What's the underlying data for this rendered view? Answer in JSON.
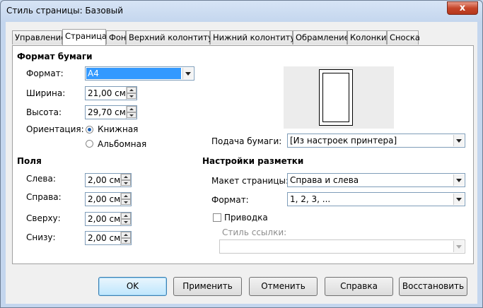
{
  "window": {
    "title": "Стиль страницы: Базовый",
    "close_glyph": "x"
  },
  "tabs": [
    {
      "label": "Управление"
    },
    {
      "label": "Страница"
    },
    {
      "label": "Фон"
    },
    {
      "label": "Верхний колонтитул"
    },
    {
      "label": "Нижний колонтитул"
    },
    {
      "label": "Обрамление"
    },
    {
      "label": "Колонки"
    },
    {
      "label": "Сноска"
    }
  ],
  "paper_format": {
    "heading": "Формат бумаги",
    "format_label": "Формат:",
    "format_value": "A4",
    "width_label": "Ширина:",
    "width_value": "21,00 см",
    "height_label": "Высота:",
    "height_value": "29,70 см",
    "orientation_label": "Ориентация:",
    "portrait_label": "Книжная",
    "landscape_label": "Альбомная",
    "paper_tray_label": "Подача бумаги:",
    "paper_tray_value": "[Из настроек принтера]"
  },
  "margins": {
    "heading": "Поля",
    "left_label": "Слева:",
    "left_value": "2,00 см",
    "right_label": "Справа:",
    "right_value": "2,00 см",
    "top_label": "Сверху:",
    "top_value": "2,00 см",
    "bottom_label": "Снизу:",
    "bottom_value": "2,00 см"
  },
  "layout": {
    "heading": "Настройки разметки",
    "page_layout_label": "Макет страницы:",
    "page_layout_value": "Справа и слева",
    "format_label": "Формат:",
    "format_value": "1, 2, 3, ...",
    "register_label": "Приводка",
    "reference_style_label": "Стиль ссылки:",
    "reference_style_value": ""
  },
  "buttons": {
    "ok": "OK",
    "apply": "Применить",
    "cancel": "Отменить",
    "help": "Справка",
    "reset": "Восстановить"
  }
}
